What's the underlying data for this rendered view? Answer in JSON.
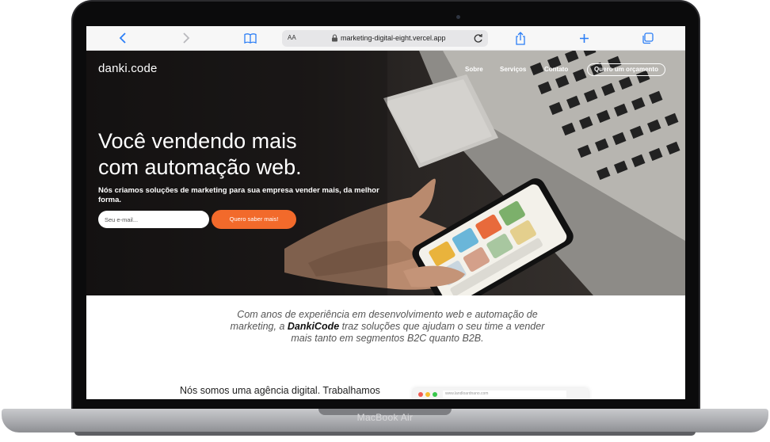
{
  "device": {
    "model_label": "MacBook Air"
  },
  "browser": {
    "text_size_label": "AA",
    "url": "marketing-digital-eight.vercel.app",
    "accent_color": "#2b7ef6"
  },
  "site": {
    "logo": "danki.code",
    "nav": [
      {
        "label": "Sobre"
      },
      {
        "label": "Serviços"
      },
      {
        "label": "Contato"
      }
    ],
    "nav_cta": "Quero um orçamento",
    "hero": {
      "title_line1": "Você vendendo mais",
      "title_line2": "com automação web.",
      "subtitle": "Nós criamos soluções de marketing para sua empresa vender mais, da melhor forma.",
      "email_placeholder": "Seu e-mail...",
      "cta_label": "Quero saber mais!",
      "cta_color": "#f26a2b"
    },
    "intro": {
      "text_before": "Com anos de experiência em desenvolvimento web e automação de marketing, a ",
      "brand": "DankiCode",
      "text_after": " traz soluções que ajudam o seu time a vender mais tanto em segmentos B2C quanto B2B."
    },
    "agency_text": "Nós somos uma agência digital. Trabalhamos",
    "mini_browser_url": "www.landloardnano.com"
  }
}
